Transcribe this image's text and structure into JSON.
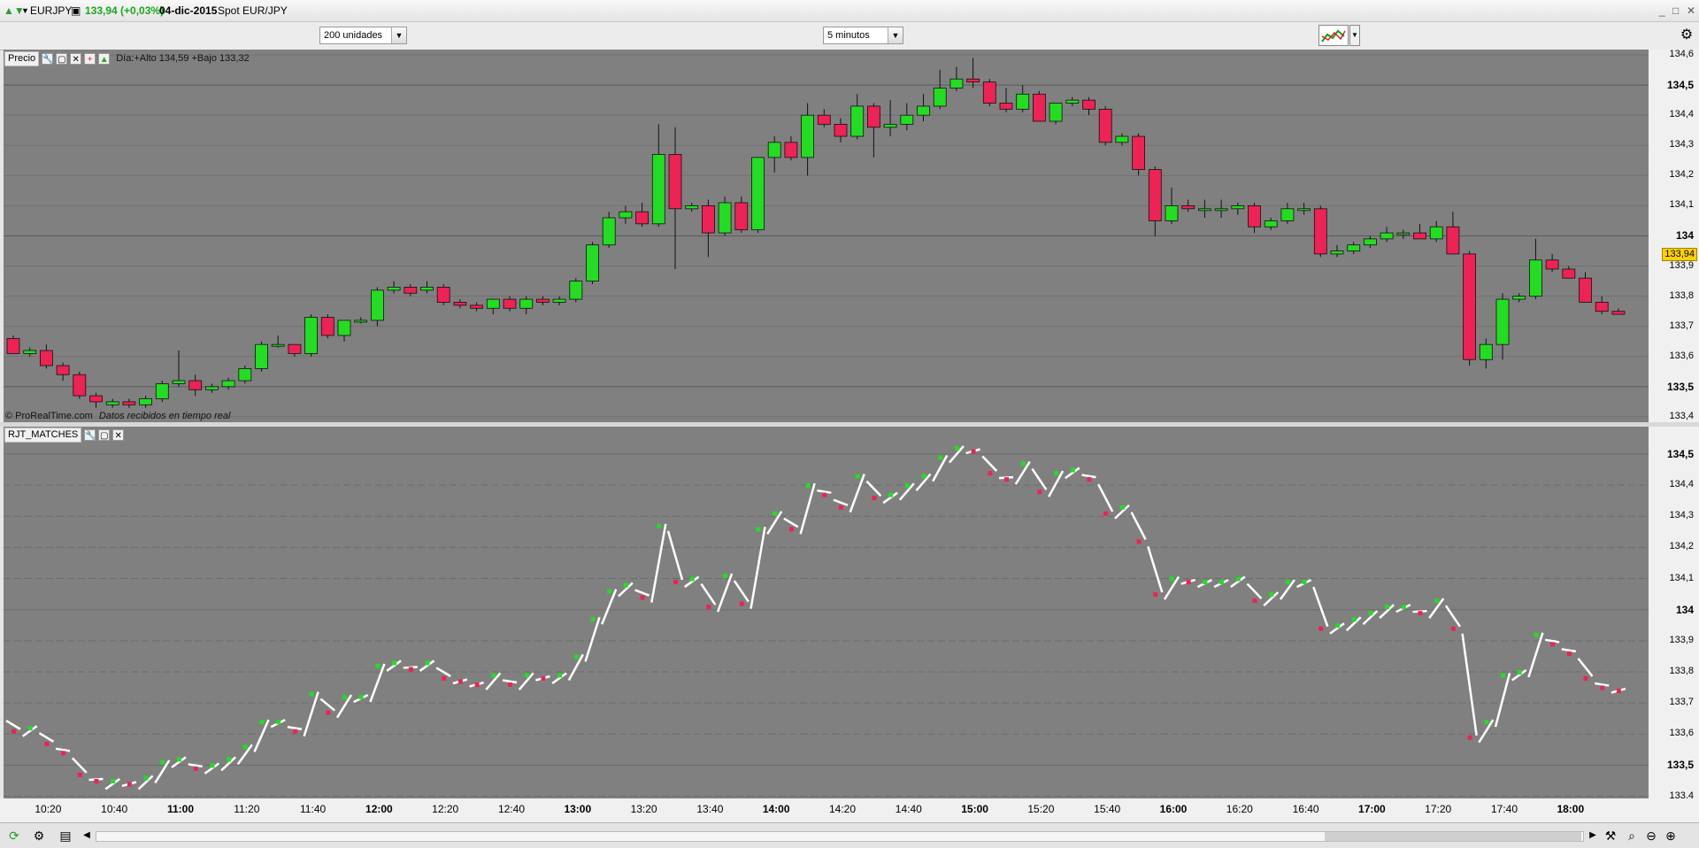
{
  "window": {
    "symbol": "EURJPY",
    "last": "133,94 (+0,03%)",
    "date": "04-dic-2015",
    "description": "Spot EUR/JPY",
    "controls": [
      "_",
      "□",
      "X"
    ]
  },
  "toolbar": {
    "units": "200 unidades",
    "interval": "5 minutos"
  },
  "price_panel": {
    "title": "Precio",
    "info": "Día:+Alto 134,59 +Bajo 133,32",
    "footer": "© ProRealTime.com",
    "footer_note": "Datos recibidos en tiempo real",
    "last_badge": "133,94",
    "up_color": "#22dd22",
    "down_color": "#ee2255"
  },
  "indicator_panel": {
    "title": "RJT_MATCHES"
  },
  "y_axis_price": [
    {
      "v": 134.6,
      "label": "134,6",
      "bold": false
    },
    {
      "v": 134.5,
      "label": "134,5",
      "bold": true
    },
    {
      "v": 134.4,
      "label": "134,4",
      "bold": false
    },
    {
      "v": 134.3,
      "label": "134,3",
      "bold": false
    },
    {
      "v": 134.2,
      "label": "134,2",
      "bold": false
    },
    {
      "v": 134.1,
      "label": "134,1",
      "bold": false
    },
    {
      "v": 134.0,
      "label": "134",
      "bold": true
    },
    {
      "v": 133.9,
      "label": "133,9",
      "bold": false
    },
    {
      "v": 133.8,
      "label": "133,8",
      "bold": false
    },
    {
      "v": 133.7,
      "label": "133,7",
      "bold": false
    },
    {
      "v": 133.6,
      "label": "133,6",
      "bold": false
    },
    {
      "v": 133.5,
      "label": "133,5",
      "bold": true
    },
    {
      "v": 133.4,
      "label": "133,4",
      "bold": false
    }
  ],
  "y_axis_indicator": [
    {
      "v": 134.5,
      "label": "134,5",
      "bold": true
    },
    {
      "v": 134.4,
      "label": "134,4",
      "bold": false
    },
    {
      "v": 134.3,
      "label": "134,3",
      "bold": false
    },
    {
      "v": 134.2,
      "label": "134,2",
      "bold": false
    },
    {
      "v": 134.1,
      "label": "134,1",
      "bold": false
    },
    {
      "v": 134.0,
      "label": "134",
      "bold": true
    },
    {
      "v": 133.9,
      "label": "133,9",
      "bold": false
    },
    {
      "v": 133.8,
      "label": "133,8",
      "bold": false
    },
    {
      "v": 133.7,
      "label": "133,7",
      "bold": false
    },
    {
      "v": 133.6,
      "label": "133,6",
      "bold": false
    },
    {
      "v": 133.5,
      "label": "133,5",
      "bold": true
    },
    {
      "v": 133.4,
      "label": "133,4",
      "bold": false
    }
  ],
  "x_axis": [
    {
      "i": 2,
      "label": "10:20",
      "bold": false
    },
    {
      "i": 6,
      "label": "10:40",
      "bold": false
    },
    {
      "i": 10,
      "label": "11:00",
      "bold": true
    },
    {
      "i": 14,
      "label": "11:20",
      "bold": false
    },
    {
      "i": 18,
      "label": "11:40",
      "bold": false
    },
    {
      "i": 22,
      "label": "12:00",
      "bold": true
    },
    {
      "i": 26,
      "label": "12:20",
      "bold": false
    },
    {
      "i": 30,
      "label": "12:40",
      "bold": false
    },
    {
      "i": 34,
      "label": "13:00",
      "bold": true
    },
    {
      "i": 38,
      "label": "13:20",
      "bold": false
    },
    {
      "i": 42,
      "label": "13:40",
      "bold": false
    },
    {
      "i": 46,
      "label": "14:00",
      "bold": true
    },
    {
      "i": 50,
      "label": "14:20",
      "bold": false
    },
    {
      "i": 54,
      "label": "14:40",
      "bold": false
    },
    {
      "i": 58,
      "label": "15:00",
      "bold": true
    },
    {
      "i": 62,
      "label": "15:20",
      "bold": false
    },
    {
      "i": 66,
      "label": "15:40",
      "bold": false
    },
    {
      "i": 70,
      "label": "16:00",
      "bold": true
    },
    {
      "i": 74,
      "label": "16:20",
      "bold": false
    },
    {
      "i": 78,
      "label": "16:40",
      "bold": false
    },
    {
      "i": 82,
      "label": "17:00",
      "bold": true
    },
    {
      "i": 86,
      "label": "17:20",
      "bold": false
    },
    {
      "i": 90,
      "label": "17:40",
      "bold": false
    },
    {
      "i": 94,
      "label": "18:00",
      "bold": true
    }
  ],
  "chart_data": {
    "type": "candlestick",
    "title": "",
    "ylim": [
      133.4,
      134.6
    ],
    "series": [
      {
        "name": "Precio",
        "ohlc": [
          [
            133.66,
            133.67,
            133.61,
            133.61
          ],
          [
            133.61,
            133.63,
            133.6,
            133.62
          ],
          [
            133.62,
            133.64,
            133.56,
            133.57
          ],
          [
            133.57,
            133.58,
            133.52,
            133.54
          ],
          [
            133.54,
            133.55,
            133.46,
            133.47
          ],
          [
            133.47,
            133.48,
            133.43,
            133.45
          ],
          [
            133.44,
            133.46,
            133.43,
            133.45
          ],
          [
            133.45,
            133.46,
            133.43,
            133.44
          ],
          [
            133.44,
            133.47,
            133.43,
            133.46
          ],
          [
            133.46,
            133.52,
            133.45,
            133.51
          ],
          [
            133.51,
            133.62,
            133.5,
            133.52
          ],
          [
            133.52,
            133.54,
            133.47,
            133.49
          ],
          [
            133.49,
            133.51,
            133.48,
            133.5
          ],
          [
            133.5,
            133.53,
            133.49,
            133.52
          ],
          [
            133.52,
            133.57,
            133.51,
            133.56
          ],
          [
            133.56,
            133.65,
            133.55,
            133.64
          ],
          [
            133.64,
            133.67,
            133.63,
            133.64
          ],
          [
            133.64,
            133.64,
            133.6,
            133.61
          ],
          [
            133.61,
            133.74,
            133.6,
            133.73
          ],
          [
            133.73,
            133.74,
            133.66,
            133.67
          ],
          [
            133.67,
            133.72,
            133.65,
            133.72
          ],
          [
            133.72,
            133.73,
            133.71,
            133.72
          ],
          [
            133.72,
            133.83,
            133.7,
            133.82
          ],
          [
            133.82,
            133.85,
            133.81,
            133.83
          ],
          [
            133.83,
            133.84,
            133.8,
            133.81
          ],
          [
            133.82,
            133.85,
            133.81,
            133.83
          ],
          [
            133.83,
            133.84,
            133.77,
            133.78
          ],
          [
            133.78,
            133.79,
            133.76,
            133.77
          ],
          [
            133.77,
            133.78,
            133.75,
            133.76
          ],
          [
            133.76,
            133.79,
            133.74,
            133.79
          ],
          [
            133.79,
            133.8,
            133.75,
            133.76
          ],
          [
            133.76,
            133.8,
            133.74,
            133.79
          ],
          [
            133.79,
            133.8,
            133.77,
            133.78
          ],
          [
            133.78,
            133.8,
            133.77,
            133.79
          ],
          [
            133.79,
            133.86,
            133.78,
            133.85
          ],
          [
            133.85,
            133.98,
            133.84,
            133.97
          ],
          [
            133.97,
            134.08,
            133.96,
            134.06
          ],
          [
            134.06,
            134.1,
            134.04,
            134.08
          ],
          [
            134.08,
            134.11,
            134.03,
            134.04
          ],
          [
            134.04,
            134.37,
            134.03,
            134.27
          ],
          [
            134.27,
            134.36,
            133.89,
            134.09
          ],
          [
            134.09,
            134.11,
            134.08,
            134.1
          ],
          [
            134.1,
            134.12,
            133.93,
            134.01
          ],
          [
            134.01,
            134.13,
            134.0,
            134.11
          ],
          [
            134.11,
            134.13,
            134.01,
            134.02
          ],
          [
            134.02,
            134.26,
            134.01,
            134.26
          ],
          [
            134.26,
            134.33,
            134.21,
            134.31
          ],
          [
            134.31,
            134.33,
            134.25,
            134.26
          ],
          [
            134.26,
            134.44,
            134.2,
            134.4
          ],
          [
            134.4,
            134.42,
            134.36,
            134.37
          ],
          [
            134.37,
            134.39,
            134.31,
            134.33
          ],
          [
            134.33,
            134.47,
            134.32,
            134.43
          ],
          [
            134.43,
            134.44,
            134.26,
            134.36
          ],
          [
            134.36,
            134.45,
            134.33,
            134.37
          ],
          [
            134.37,
            134.44,
            134.35,
            134.4
          ],
          [
            134.4,
            134.47,
            134.38,
            134.43
          ],
          [
            134.43,
            134.55,
            134.42,
            134.49
          ],
          [
            134.49,
            134.56,
            134.48,
            134.52
          ],
          [
            134.52,
            134.59,
            134.49,
            134.51
          ],
          [
            134.51,
            134.52,
            134.43,
            134.44
          ],
          [
            134.44,
            134.49,
            134.41,
            134.42
          ],
          [
            134.42,
            134.5,
            134.41,
            134.47
          ],
          [
            134.47,
            134.48,
            134.38,
            134.38
          ],
          [
            134.38,
            134.44,
            134.37,
            134.44
          ],
          [
            134.44,
            134.46,
            134.43,
            134.45
          ],
          [
            134.45,
            134.46,
            134.4,
            134.42
          ],
          [
            134.42,
            134.43,
            134.3,
            134.31
          ],
          [
            134.31,
            134.34,
            134.3,
            134.33
          ],
          [
            134.33,
            134.34,
            134.2,
            134.22
          ],
          [
            134.22,
            134.23,
            134.0,
            134.05
          ],
          [
            134.05,
            134.16,
            134.04,
            134.1
          ],
          [
            134.1,
            134.12,
            134.08,
            134.09
          ],
          [
            134.09,
            134.12,
            134.06,
            134.09
          ],
          [
            134.09,
            134.12,
            134.06,
            134.09
          ],
          [
            134.09,
            134.11,
            134.07,
            134.1
          ],
          [
            134.1,
            134.11,
            134.01,
            134.03
          ],
          [
            134.03,
            134.06,
            134.02,
            134.05
          ],
          [
            134.05,
            134.11,
            134.04,
            134.09
          ],
          [
            134.09,
            134.11,
            134.07,
            134.09
          ],
          [
            134.09,
            134.1,
            133.93,
            133.94
          ],
          [
            133.94,
            133.97,
            133.93,
            133.95
          ],
          [
            133.95,
            133.98,
            133.94,
            133.97
          ],
          [
            133.97,
            134.0,
            133.96,
            133.99
          ],
          [
            133.99,
            134.03,
            133.98,
            134.01
          ],
          [
            134.01,
            134.02,
            133.99,
            134.01
          ],
          [
            134.01,
            134.04,
            133.99,
            133.99
          ],
          [
            133.99,
            134.05,
            133.98,
            134.03
          ],
          [
            134.03,
            134.08,
            133.94,
            133.94
          ],
          [
            133.94,
            133.95,
            133.57,
            133.59
          ],
          [
            133.59,
            133.66,
            133.56,
            133.64
          ],
          [
            133.64,
            133.81,
            133.59,
            133.79
          ],
          [
            133.79,
            133.81,
            133.78,
            133.8
          ],
          [
            133.8,
            133.99,
            133.79,
            133.92
          ],
          [
            133.92,
            133.94,
            133.88,
            133.89
          ],
          [
            133.89,
            133.9,
            133.86,
            133.86
          ],
          [
            133.86,
            133.88,
            133.78,
            133.78
          ],
          [
            133.78,
            133.8,
            133.74,
            133.75
          ],
          [
            133.75,
            133.76,
            133.74,
            133.74
          ]
        ]
      }
    ]
  }
}
